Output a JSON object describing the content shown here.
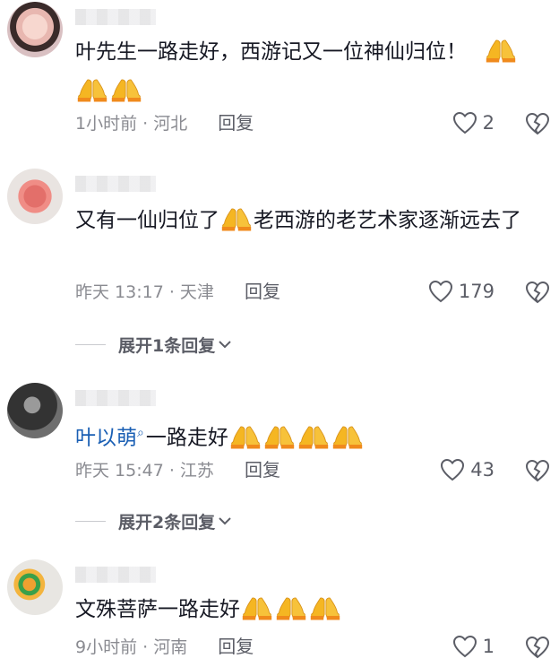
{
  "comments": [
    {
      "text": "叶先生一路走好，西游记又一位神仙归位！",
      "time_location": "1小时前 · 河北",
      "reply_label": "回复",
      "likes": "2"
    },
    {
      "text_a": "又有一仙归位了",
      "text_b": "老西游的老艺术家逐渐远去了",
      "time_location": "昨天 13:17 · 天津",
      "reply_label": "回复",
      "likes": "179",
      "expand_label": "展开1条回复"
    },
    {
      "mention": "叶以萌",
      "text": "一路走好",
      "time_location": "昨天 15:47 · 江苏",
      "reply_label": "回复",
      "likes": "43",
      "expand_label": "展开2条回复"
    },
    {
      "text": "文殊菩萨一路走好",
      "time_location": "9小时前 · 河南",
      "reply_label": "回复",
      "likes": "1"
    }
  ],
  "icons": {
    "like": "heart-outline-icon",
    "dislike": "broken-heart-icon",
    "expand": "chevron-down-icon",
    "emoji": "folded-hands-emoji"
  },
  "colors": {
    "text": "#161823",
    "meta": "#8a8b91",
    "mention": "#1a5fb4",
    "emoji": "#f5b622"
  }
}
